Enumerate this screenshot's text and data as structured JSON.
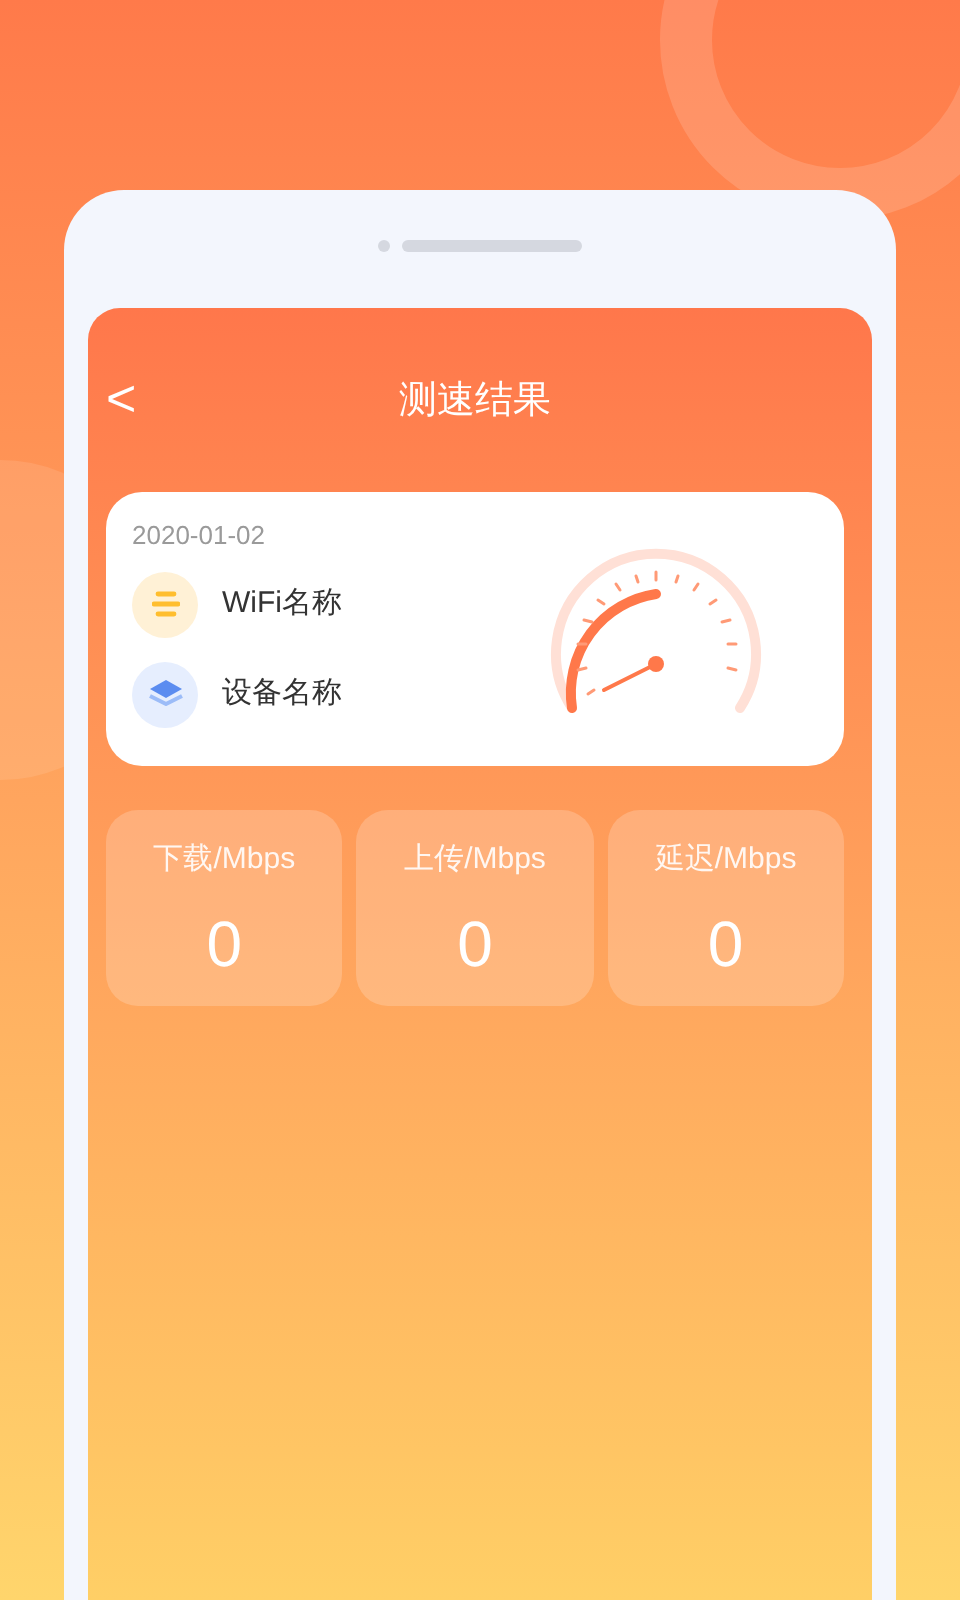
{
  "header": {
    "back": "<",
    "title": "测速结果"
  },
  "info": {
    "date": "2020-01-02",
    "rows": [
      {
        "kind": "wifi",
        "label": "WiFi名称"
      },
      {
        "kind": "device",
        "label": "设备名称"
      }
    ]
  },
  "stats": [
    {
      "label": "下载/Mbps",
      "value": "0"
    },
    {
      "label": "上传/Mbps",
      "value": "0"
    },
    {
      "label": "延迟/Mbps",
      "value": "0"
    }
  ]
}
